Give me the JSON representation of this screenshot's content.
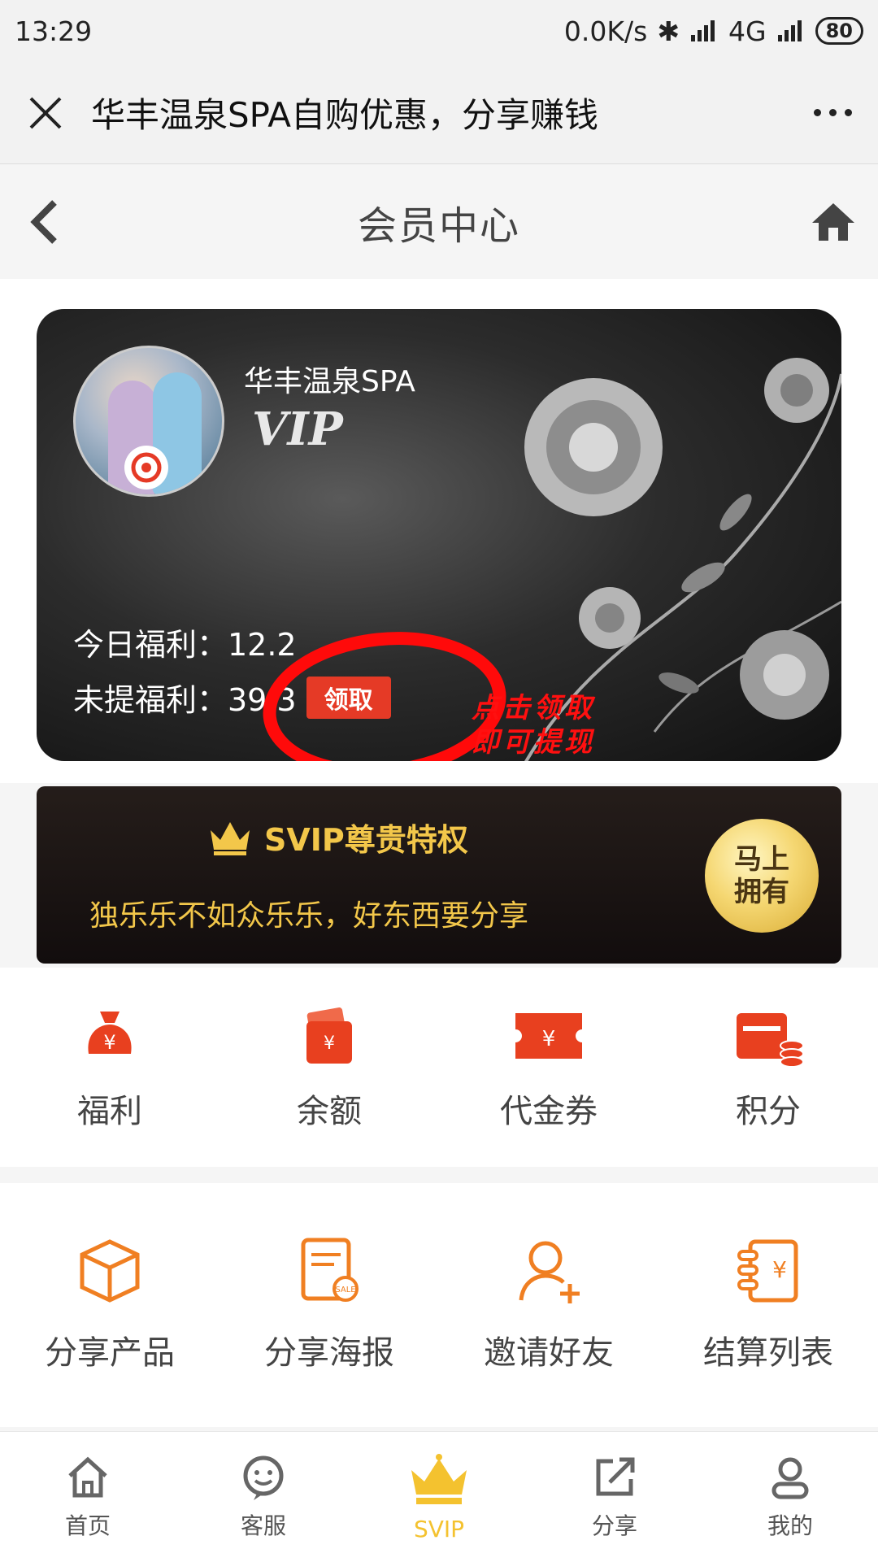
{
  "status_bar": {
    "time": "13:29",
    "network_speed": "0.0K/s",
    "network_type": "4G",
    "battery": "80"
  },
  "navbar": {
    "title": "华丰温泉SPA自购优惠，分享赚钱"
  },
  "page_header": {
    "title": "会员中心"
  },
  "vip_card": {
    "brand": "华丰温泉SPA",
    "tier": "VIP",
    "today_welfare": "今日福利：12.2",
    "unclaimed_welfare": "未提福利：39 3",
    "claim_label": "领取",
    "annotation_line1": "点击领取",
    "annotation_line2": "即可提现"
  },
  "svip_banner": {
    "title": "SVIP尊贵特权",
    "subtitle": "独乐乐不如众乐乐，好东西要分享",
    "cta_line1": "马上",
    "cta_line2": "拥有"
  },
  "assets": [
    {
      "label": "福利",
      "icon": "money-bag-icon"
    },
    {
      "label": "余额",
      "icon": "wallet-icon"
    },
    {
      "label": "代金券",
      "icon": "coupon-icon"
    },
    {
      "label": "积分",
      "icon": "points-icon"
    }
  ],
  "actions": [
    {
      "label": "分享产品",
      "icon": "box-icon"
    },
    {
      "label": "分享海报",
      "icon": "poster-icon"
    },
    {
      "label": "邀请好友",
      "icon": "add-user-icon"
    },
    {
      "label": "结算列表",
      "icon": "settlement-icon"
    }
  ],
  "tabbar": [
    {
      "label": "首页",
      "icon": "home-icon"
    },
    {
      "label": "客服",
      "icon": "service-icon"
    },
    {
      "label": "SVIP",
      "icon": "crown-icon",
      "active": true
    },
    {
      "label": "分享",
      "icon": "share-icon"
    },
    {
      "label": "我的",
      "icon": "user-icon"
    }
  ],
  "colors": {
    "accent_red": "#e53a26",
    "gold": "#f3c74a",
    "icon_orange": "#f07f22"
  }
}
